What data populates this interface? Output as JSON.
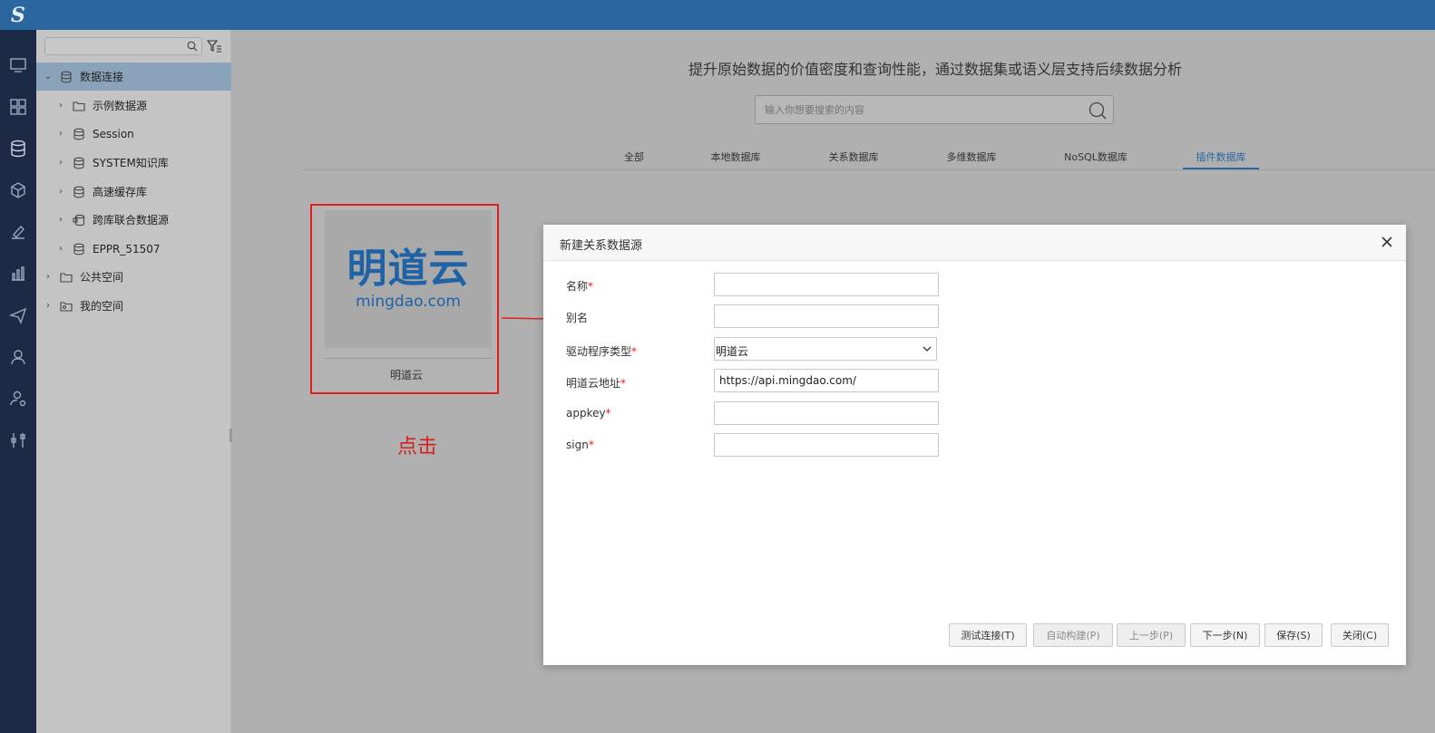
{
  "app": {
    "logo_text": "S"
  },
  "rail": {
    "icons": [
      "monitor-icon",
      "dashboard-icon",
      "database-icon",
      "cube-icon",
      "design-icon",
      "chart-icon",
      "send-icon",
      "admin-icon",
      "user-settings-icon",
      "tools-icon"
    ]
  },
  "tree": {
    "search_placeholder": "",
    "items": [
      {
        "label": "数据连接",
        "level": 0,
        "expanded": true,
        "selected": true,
        "icon": "database-connection-icon"
      },
      {
        "label": "示例数据源",
        "level": 1,
        "icon": "folder-icon"
      },
      {
        "label": "Session",
        "level": 1,
        "icon": "db-icon"
      },
      {
        "label": "SYSTEM知识库",
        "level": 1,
        "icon": "db-icon"
      },
      {
        "label": "高速缓存库",
        "level": 1,
        "icon": "db-icon"
      },
      {
        "label": "跨库联合数据源",
        "level": 1,
        "icon": "federated-db-icon"
      },
      {
        "label": "EPPR_51507",
        "level": 1,
        "icon": "db-icon"
      },
      {
        "label": "公共空间",
        "level": 0,
        "icon": "folder-icon"
      },
      {
        "label": "我的空间",
        "level": 0,
        "icon": "user-folder-icon"
      }
    ]
  },
  "main": {
    "headline": "提升原始数据的价值密度和查询性能，通过数据集或语义层支持后续数据分析",
    "search_placeholder": "输入你想要搜索的内容",
    "tabs": [
      {
        "label": "全部"
      },
      {
        "label": "本地数据库"
      },
      {
        "label": "关系数据库"
      },
      {
        "label": "多维数据库"
      },
      {
        "label": "NoSQL数据库"
      },
      {
        "label": "插件数据库",
        "active": true
      }
    ],
    "card": {
      "brand_cn": "明道云",
      "brand_en": "mingdao.com",
      "label": "明道云"
    },
    "click_note": "点击"
  },
  "dialog": {
    "title": "新建关系数据源",
    "fields": [
      {
        "label": "名称",
        "required": true,
        "value": ""
      },
      {
        "label": "别名",
        "required": false,
        "value": ""
      },
      {
        "label": "驱动程序类型",
        "required": true,
        "value": "明道云",
        "type": "select"
      },
      {
        "label": "明道云地址",
        "required": true,
        "value": "https://api.mingdao.com/"
      },
      {
        "label": "appkey",
        "required": true,
        "value": ""
      },
      {
        "label": "sign",
        "required": true,
        "value": ""
      }
    ],
    "required_mark": "*",
    "buttons": {
      "test": "测试连接(T)",
      "auto_build": "自动构建(P)",
      "prev": "上一步(P)",
      "next": "下一步(N)",
      "save": "保存(S)",
      "close": "关闭(C)"
    }
  },
  "colors": {
    "topbar": "#2b679f",
    "rail": "#1c2a46",
    "accent": "#2b679f",
    "highlight": "#e02020",
    "brand": "#2062a6"
  }
}
